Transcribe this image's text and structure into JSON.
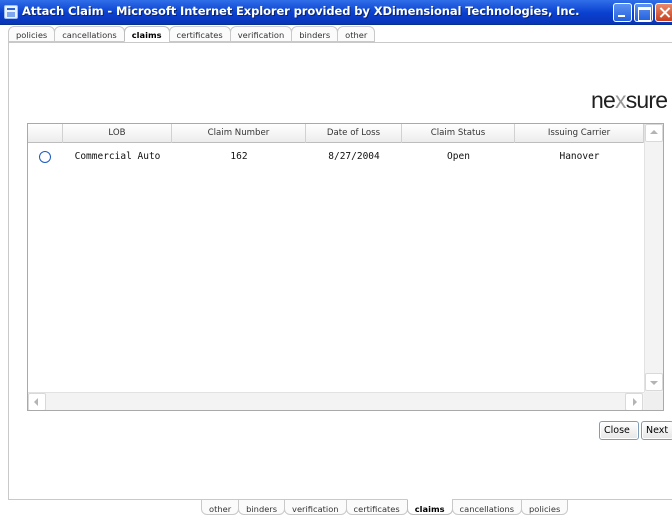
{
  "window": {
    "title": "Attach Claim - Microsoft Internet Explorer provided by XDimensional Technologies, Inc.",
    "app_icon": "ie-window-icon",
    "controls": [
      "minimize-icon",
      "maximize-icon",
      "close-icon"
    ]
  },
  "top_tabs": [
    {
      "label": "policies",
      "active": false
    },
    {
      "label": "cancellations",
      "active": false
    },
    {
      "label": "claims",
      "active": true
    },
    {
      "label": "certificates",
      "active": false
    },
    {
      "label": "verification",
      "active": false
    },
    {
      "label": "binders",
      "active": false
    },
    {
      "label": "other",
      "active": false
    }
  ],
  "bottom_tabs": [
    {
      "label": "other",
      "active": false
    },
    {
      "label": "binders",
      "active": false
    },
    {
      "label": "verification",
      "active": false
    },
    {
      "label": "certificates",
      "active": false
    },
    {
      "label": "claims",
      "active": true
    },
    {
      "label": "cancellations",
      "active": false
    },
    {
      "label": "policies",
      "active": false
    }
  ],
  "logo": {
    "before": "ne",
    "mark": "x",
    "after": "sure"
  },
  "grid": {
    "columns": [
      "",
      "LOB",
      "Claim Number",
      "Date of Loss",
      "Claim Status",
      "Issuing Carrier"
    ],
    "rows": [
      {
        "selected": false,
        "lob": "Commercial Auto",
        "claim_number": "162",
        "date_of_loss": "8/27/2004",
        "claim_status": "Open",
        "issuing_carrier": "Hanover"
      }
    ]
  },
  "buttons": {
    "close": "Close",
    "next": "Next"
  }
}
